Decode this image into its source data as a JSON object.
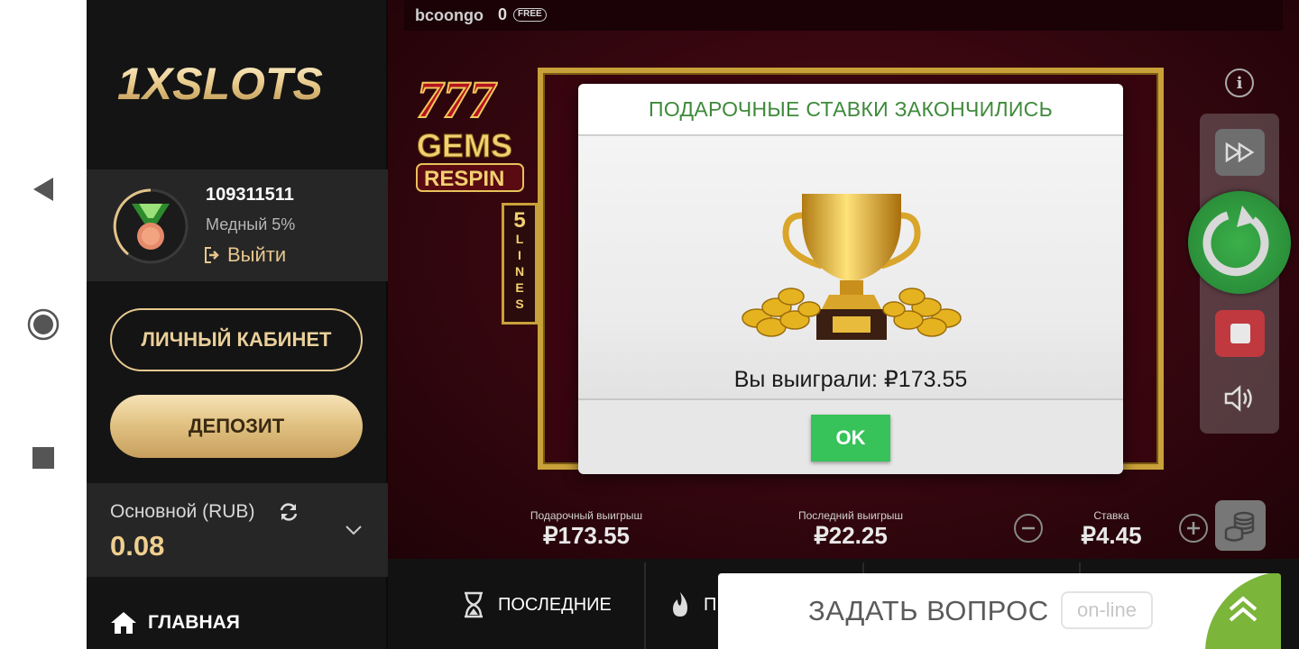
{
  "sidebar": {
    "logo_text": "1XSLOTS",
    "account_id": "109311511",
    "rank": "Медный 5%",
    "logout_label": "Выйти",
    "cabinet_label": "ЛИЧНЫЙ КАБИНЕТ",
    "deposit_label": "ДЕПОЗИТ",
    "balance_label": "Основной (RUB)",
    "balance_value": "0.08",
    "menu_home_label": "ГЛАВНАЯ"
  },
  "game": {
    "brand": "bcoongo",
    "free_count": "0",
    "free_label": "FREE",
    "logo_lines": [
      "777",
      "GEMS",
      "RESPIN"
    ],
    "lines_badge": [
      "5",
      "L",
      "I",
      "N",
      "E",
      "S"
    ],
    "info_label": "i",
    "stats": {
      "gift_label": "Подарочный выигрыш",
      "gift_value": "₽173.55",
      "last_label": "Последний выигрыш",
      "last_value": "₽22.25",
      "bet_label": "Ставка",
      "bet_value": "₽4.45"
    }
  },
  "modal": {
    "title": "ПОДАРОЧНЫЕ СТАВКИ ЗАКОНЧИЛИСЬ",
    "win_text": "Вы выиграли: ₽173.55",
    "ok_label": "OK"
  },
  "bottom_tabs": {
    "recent_label": "ПОСЛЕДНИЕ",
    "hot_label": "П"
  },
  "ask": {
    "label": "ЗАДАТЬ ВОПРОС",
    "status": "on-line"
  },
  "colors": {
    "gold": "#e6c98f",
    "spin_green": "#2b8f3a",
    "modal_title_green": "#3f8a3b",
    "ok_green": "#37c25a",
    "ask_green": "#7bb53a"
  }
}
